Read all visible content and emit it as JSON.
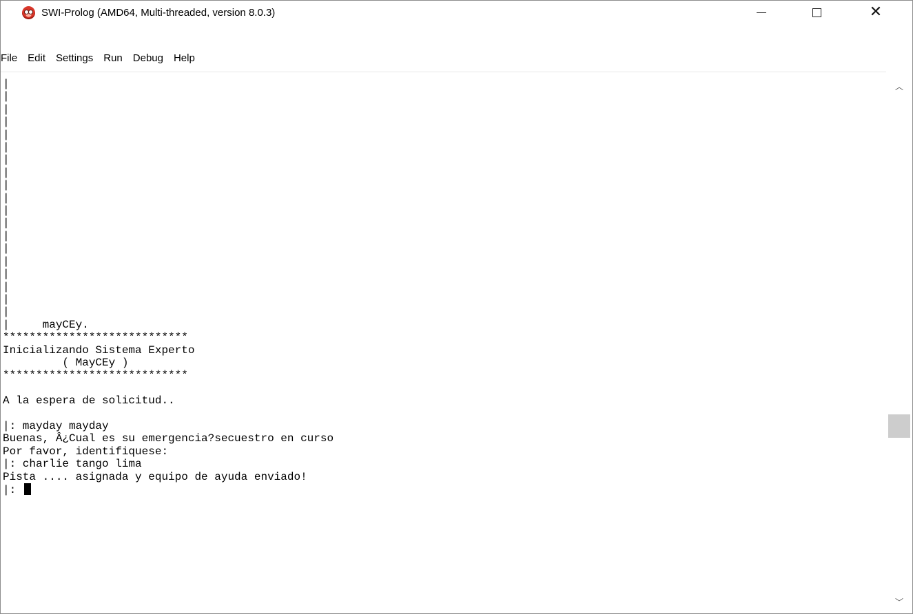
{
  "window": {
    "title": "SWI-Prolog (AMD64, Multi-threaded, version 8.0.3)",
    "icon": "swi-prolog-owl-icon",
    "controls": {
      "minimize": "minimize-icon",
      "maximize": "maximize-icon",
      "close": "close-icon"
    }
  },
  "menubar": {
    "items": [
      "File",
      "Edit",
      "Settings",
      "Run",
      "Debug",
      "Help"
    ]
  },
  "console": {
    "lines": [
      "|",
      "|",
      "|",
      "|",
      "|",
      "|",
      "|",
      "|",
      "|",
      "|",
      "|",
      "|",
      "|",
      "|",
      "|",
      "|",
      "|",
      "|",
      "|",
      "|     mayCEy.",
      "****************************",
      "Inicializando Sistema Experto",
      "         ( MayCEy )",
      "****************************",
      "",
      "A la espera de solicitud..",
      "",
      "|: mayday mayday",
      "Buenas, Â¿Cual es su emergencia?secuestro en curso",
      "Por favor, identifiquese:",
      "|: charlie tango lima",
      "Pista .... asignada y equipo de ayuda enviado!",
      "|: "
    ]
  },
  "scrollbar": {
    "up": "chevron-up-icon",
    "down": "chevron-down-icon"
  }
}
